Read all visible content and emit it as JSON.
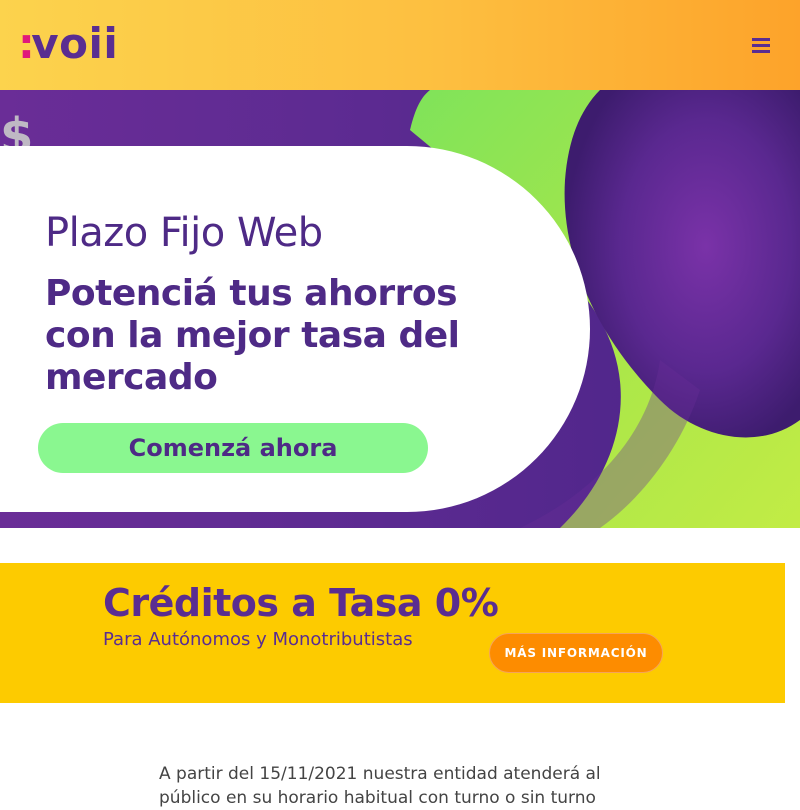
{
  "header": {
    "logo_dots": ":",
    "logo_text": "voii",
    "menu_icon": "hamburger-menu-icon"
  },
  "hero": {
    "title": "Plazo Fijo Web",
    "heading": "Potenciá tus ahorros con la mejor tasa del mercado",
    "cta_label": "Comenzá ahora",
    "decor_icon": "dollar-sign-icon",
    "decor_text": "$"
  },
  "promo": {
    "title": "Créditos a Tasa 0%",
    "subtitle": "Para Autónomos y Monotributistas",
    "button_label": "MÁS INFORMACIÓN"
  },
  "notice": {
    "text": "A partir del 15/11/2021 nuestra entidad atenderá al público en su horario habitual con turno o sin turno"
  },
  "colors": {
    "brand_purple": "#5a2d91",
    "brand_magenta": "#e0197c",
    "header_yellow": "#fcd34d",
    "header_orange": "#fda32a",
    "cta_green": "#8af790",
    "promo_yellow": "#fdcb00",
    "promo_orange": "#fd8c00"
  }
}
